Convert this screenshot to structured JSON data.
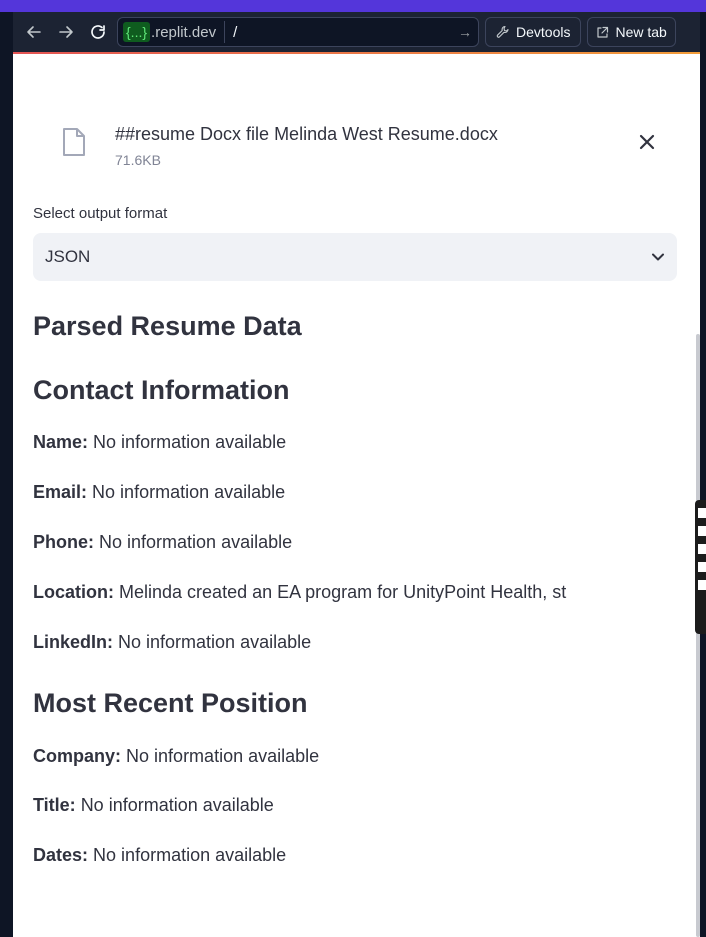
{
  "browser": {
    "url_badge": "{...}",
    "url_host_suffix": ".replit.dev",
    "url_path": "/",
    "devtools_label": "Devtools",
    "newtab_label": "New tab"
  },
  "upload": {
    "file_name": "##resume Docx file Melinda West Resume.docx",
    "file_size": "71.6KB"
  },
  "format_select": {
    "label": "Select output format",
    "value": "JSON"
  },
  "headings": {
    "parsed": "Parsed Resume Data",
    "contact": "Contact Information",
    "recent": "Most Recent Position"
  },
  "contact": {
    "name_label": "Name:",
    "name_value": "No information available",
    "email_label": "Email:",
    "email_value": "No information available",
    "phone_label": "Phone:",
    "phone_value": "No information available",
    "location_label": "Location:",
    "location_value": "Melinda created an EA program for UnityPoint Health, st",
    "linkedin_label": "LinkedIn:",
    "linkedin_value": "No information available"
  },
  "position": {
    "company_label": "Company:",
    "company_value": "No information available",
    "title_label": "Title:",
    "title_value": "No information available",
    "dates_label": "Dates:",
    "dates_value": "No information available"
  },
  "colors": {
    "accent": "#5436da",
    "url_badge_bg": "#0f5c1f",
    "url_badge_text": "#60e87a"
  }
}
